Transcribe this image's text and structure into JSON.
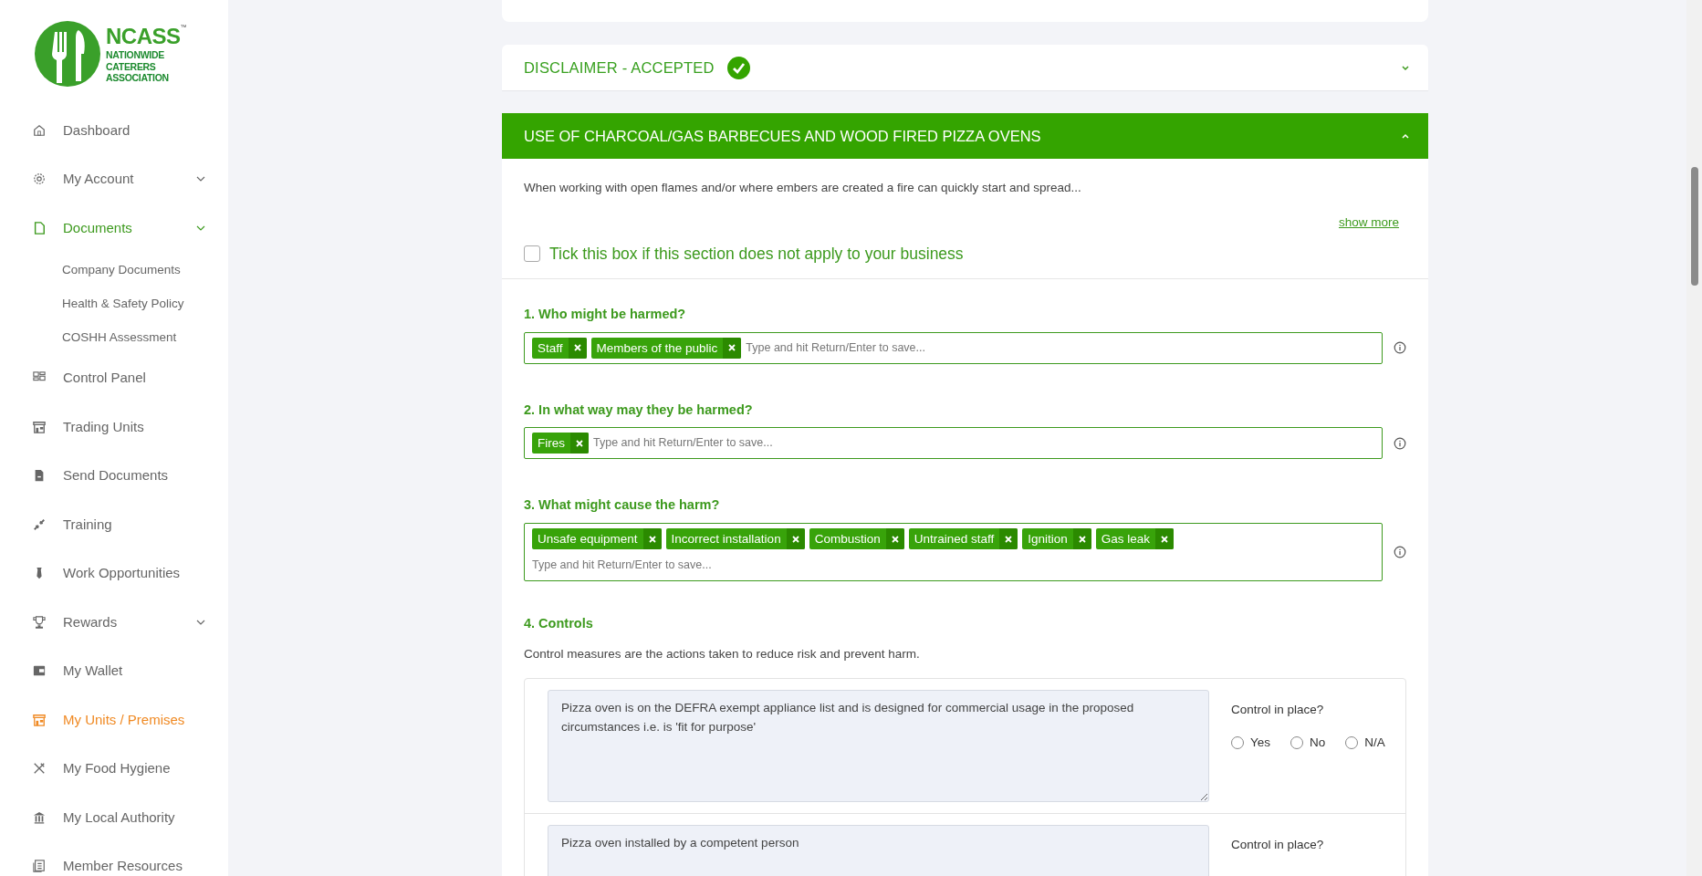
{
  "logo": {
    "brand": "NCASS",
    "tm": "™",
    "lines": [
      "NATIONWIDE",
      "CATERERS",
      "ASSOCIATION"
    ]
  },
  "sidebar": {
    "items": [
      {
        "label": "Dashboard",
        "selected": false
      },
      {
        "label": "My Account",
        "selected": false,
        "expanded": false
      },
      {
        "label": "Documents",
        "selected": false,
        "expanded": true,
        "children": [
          {
            "label": "Company Documents"
          },
          {
            "label": "Health & Safety Policy"
          },
          {
            "label": "COSHH Assessment"
          }
        ]
      },
      {
        "label": "Control Panel",
        "selected": false
      },
      {
        "label": "Trading Units",
        "selected": false
      },
      {
        "label": "Send Documents",
        "selected": false
      },
      {
        "label": "Training",
        "selected": false
      },
      {
        "label": "Work Opportunities",
        "selected": false
      },
      {
        "label": "Rewards",
        "selected": false,
        "expanded": false
      },
      {
        "label": "My Wallet",
        "selected": false
      },
      {
        "label": "My Units / Premises",
        "selected": true
      },
      {
        "label": "My Food Hygiene",
        "selected": false
      },
      {
        "label": "My Local Authority",
        "selected": false
      },
      {
        "label": "Member Resources",
        "selected": false
      }
    ]
  },
  "disclaimer": {
    "title": "DISCLAIMER - ACCEPTED",
    "accepted": true,
    "expanded": false
  },
  "section": {
    "title": "USE OF CHARCOAL/GAS BARBECUES AND WOOD FIRED PIZZA OVENS",
    "expanded": true,
    "intro": "When working with open flames and/or where embers are created a fire can quickly start and spread...",
    "show_more": "show more",
    "not_applicable": {
      "label": "Tick this box if this section does not apply to your business",
      "checked": false
    },
    "questions": [
      {
        "title": "1. Who might be harmed?",
        "tags": [
          "Staff",
          "Members of the public"
        ],
        "placeholder": "Type and hit Return/Enter to save..."
      },
      {
        "title": "2. In what way may they be harmed?",
        "tags": [
          "Fires"
        ],
        "placeholder": "Type and hit Return/Enter to save..."
      },
      {
        "title": "3. What might cause the harm?",
        "tags": [
          "Unsafe equipment",
          "Incorrect installation",
          "Combustion",
          "Untrained staff",
          "Ignition",
          "Gas leak"
        ],
        "placeholder": "Type and hit Return/Enter to save..."
      }
    ],
    "controls": {
      "title": "4. Controls",
      "description": "Control measures are the actions taken to reduce risk and prevent harm.",
      "items": [
        {
          "text": "Pizza oven is on the DEFRA exempt appliance list and is designed for commercial usage in the proposed circumstances i.e. is 'fit for purpose'",
          "question": "Control in place?",
          "options": [
            {
              "label": "Yes",
              "selected": false
            },
            {
              "label": "No",
              "selected": false
            },
            {
              "label": "N/A",
              "selected": false
            }
          ]
        },
        {
          "text": "Pizza oven installed by a competent person",
          "question": "Control in place?"
        }
      ]
    }
  }
}
